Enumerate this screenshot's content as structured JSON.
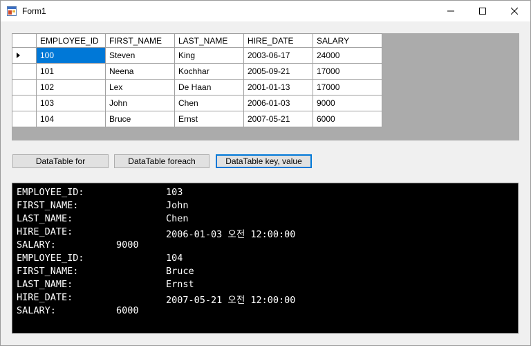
{
  "window": {
    "title": "Form1"
  },
  "grid": {
    "columns": [
      "EMPLOYEE_ID",
      "FIRST_NAME",
      "LAST_NAME",
      "HIRE_DATE",
      "SALARY"
    ],
    "rows": [
      [
        "100",
        "Steven",
        "King",
        "2003-06-17",
        "24000"
      ],
      [
        "101",
        "Neena",
        "Kochhar",
        "2005-09-21",
        "17000"
      ],
      [
        "102",
        "Lex",
        "De Haan",
        "2001-01-13",
        "17000"
      ],
      [
        "103",
        "John",
        "Chen",
        "2006-01-03",
        "9000"
      ],
      [
        "104",
        "Bruce",
        "Ernst",
        "2007-05-21",
        "6000"
      ]
    ]
  },
  "buttons": {
    "for_label": "DataTable for",
    "foreach_label": "DataTable foreach",
    "keyvalue_label": "DataTable key, value"
  },
  "console": {
    "lines": [
      {
        "key": "EMPLOYEE_ID:",
        "value": "103"
      },
      {
        "key": "FIRST_NAME:",
        "value": "John"
      },
      {
        "key": "LAST_NAME:",
        "value": "Chen"
      },
      {
        "key": "HIRE_DATE:",
        "value": "2006-01-03 오전 12:00:00"
      },
      {
        "key": "SALARY:",
        "value": "9000"
      },
      {
        "key": "EMPLOYEE_ID:",
        "value": "104"
      },
      {
        "key": "FIRST_NAME:",
        "value": "Bruce"
      },
      {
        "key": "LAST_NAME:",
        "value": "Ernst"
      },
      {
        "key": "HIRE_DATE:",
        "value": "2007-05-21 오전 12:00:00"
      },
      {
        "key": "SALARY:",
        "value": "6000"
      }
    ]
  },
  "colors": {
    "selection": "#0078d7",
    "console_bg": "#000000",
    "console_text": "#ffffff",
    "grid_bg": "#ababab"
  },
  "icons": {
    "app": "form-icon",
    "minimize": "minimize-icon",
    "maximize": "maximize-icon",
    "close": "close-icon",
    "current_row": "current-row-arrow-icon"
  }
}
